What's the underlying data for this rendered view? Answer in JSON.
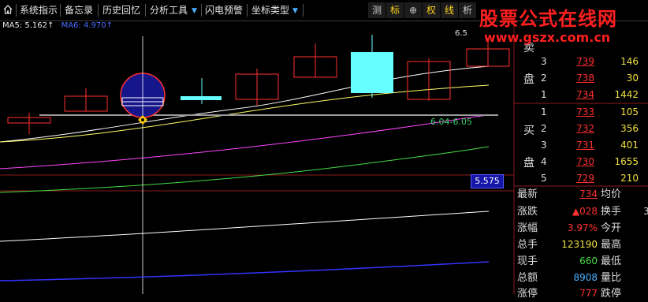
{
  "toolbar": {
    "items": [
      "系统指示",
      "备忘录",
      "历史回忆",
      "分析工具",
      "闪电预警",
      "坐标类型"
    ],
    "right_tabs": [
      "测",
      "标",
      "⊕",
      "权",
      "线",
      "析"
    ]
  },
  "watermark": {
    "line1": "股票公式在线网",
    "line2": "www.gszx.com.cn"
  },
  "chart": {
    "ma_legend": {
      "ma5": "MA5: 5.162↑",
      "ma6": "MA6: 4.970↑"
    },
    "top_price": "6.5",
    "range_label": "6.04-6.05",
    "cursor_price": "5.575",
    "colors": {
      "up": "#ff3030",
      "flat": "#66ffff",
      "ma1": "#ffffff",
      "ma2": "#ffff66",
      "ma3": "#ff44ff",
      "ma4": "#44dd44",
      "ma5": "#3333ff"
    }
  },
  "orderbook": {
    "sell_label_top": "卖",
    "sell_label_bottom": "盘",
    "buy_label_top": "买",
    "buy_label_bottom": "盘",
    "sell": [
      {
        "idx": "3",
        "price": "739",
        "vol": "146"
      },
      {
        "idx": "2",
        "price": "738",
        "vol": "30"
      },
      {
        "idx": "1",
        "price": "734",
        "vol": "1442"
      }
    ],
    "buy": [
      {
        "idx": "1",
        "price": "733",
        "vol": "105"
      },
      {
        "idx": "2",
        "price": "732",
        "vol": "356"
      },
      {
        "idx": "3",
        "price": "731",
        "vol": "401"
      },
      {
        "idx": "4",
        "price": "730",
        "vol": "1655"
      },
      {
        "idx": "5",
        "price": "729",
        "vol": "210"
      }
    ]
  },
  "quote": [
    {
      "label": "最新",
      "value": "734",
      "color": "#ff3030",
      "label2": "均价",
      "extra": ""
    },
    {
      "label": "涨跌",
      "value": "▲028",
      "color": "#ff3030",
      "label2": "换手",
      "extra": "3"
    },
    {
      "label": "涨幅",
      "value": "3.97%",
      "color": "#ff3030",
      "label2": "今开",
      "extra": ""
    },
    {
      "label": "总手",
      "value": "123190",
      "color": "#f0e040",
      "label2": "最高",
      "extra": ""
    },
    {
      "label": "现手",
      "value": "660",
      "color": "#44dd44",
      "label2": "最低",
      "extra": ""
    },
    {
      "label": "总额",
      "value": "8908",
      "color": "#4ab0ff",
      "label2": "量比",
      "extra": ""
    },
    {
      "label": "涨停",
      "value": "777",
      "color": "#ff3030",
      "label2": "跌停",
      "extra": ""
    }
  ]
}
